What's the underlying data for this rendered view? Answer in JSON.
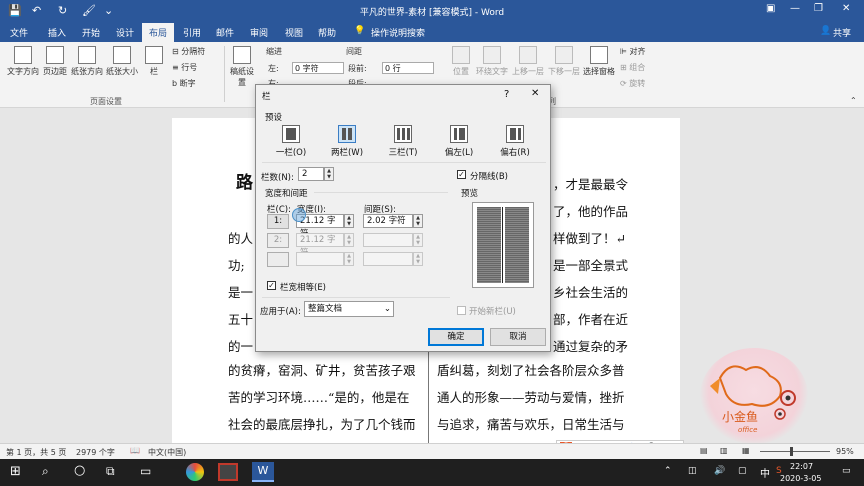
{
  "titlebar": {
    "title": "平凡的世界-素材 [兼容模式] - Word",
    "controls": {
      "min": "—",
      "restore": "❐",
      "close": "✕"
    }
  },
  "menubar": {
    "tabs": [
      "文件",
      "插入",
      "开始",
      "设计",
      "布局",
      "引用",
      "邮件",
      "审阅",
      "视图",
      "帮助"
    ],
    "search": "操作说明搜索",
    "share": "共享"
  },
  "ribbon": {
    "buttons": [
      "文字方向",
      "页边距",
      "纸张方向",
      "纸张大小",
      "栏",
      "稿纸设置"
    ],
    "breaks": "分隔符",
    "line_numbers": "行号",
    "hyphenation": "断字",
    "group_page_setup": "页面设置",
    "indent_label": "缩进",
    "indent_left_label": "左:",
    "indent_left_value": "0 字符",
    "indent_right_label": "右:",
    "spacing_label": "间距",
    "spacing_before_label": "段前:",
    "spacing_before_value": "0 行",
    "spacing_after_label": "段后:",
    "arrange": [
      "位置",
      "环绕文字",
      "上移一层",
      "下移一层",
      "选择窗格"
    ],
    "align": "对齐",
    "group": "组合",
    "rotate": "旋转",
    "group_arrange_tail": "列"
  },
  "document": {
    "left_heading": "路",
    "left_lines": [
      "的人",
      "功;",
      "是一",
      "五十",
      "的一",
      "的贫瘠，窑洞、矿井，贫苦孩子艰",
      "苦的学习环境……“是的，他是在",
      "社会的最底层挣扎，为了几个钱而"
    ],
    "right_lines": [
      "，才是最最令",
      "了，他的作品",
      "样做到了！↵",
      "是一部全景式",
      "乡社会生活的",
      "部，作者在近",
      "通过复杂的矛",
      "盾纠葛，刻划了社会各阶层众多普",
      "通人的形象——劳动与爱情，挫折",
      "与追求，痛苦与欢乐，日常生活与"
    ]
  },
  "dialog": {
    "title": "栏",
    "help": "?",
    "close": "✕",
    "presets_label": "预设",
    "presets": [
      "一栏(O)",
      "两栏(W)",
      "三栏(T)",
      "偏左(L)",
      "偏右(R)"
    ],
    "columns_label": "栏数(N):",
    "columns_value": "2",
    "separator_label": "分隔线(B)",
    "width_spacing_label": "宽度和间距",
    "col_header": "栏(C):",
    "width_header": "宽度(I):",
    "spacing_header": "间距(S):",
    "rows": [
      {
        "num": "1:",
        "width": "21.12 字符",
        "spacing": "2.02 字符"
      },
      {
        "num": "2:",
        "width": "21.12 字符",
        "spacing": ""
      }
    ],
    "equal_width_label": "栏宽相等(E)",
    "preview_label": "预览",
    "apply_label": "应用于(A):",
    "apply_value": "整篇文档",
    "new_column_label": "开始新栏(U)",
    "ok": "确定",
    "cancel": "取消"
  },
  "statusbar": {
    "page": "第 1 页，共 5 页",
    "words": "2979 个字",
    "lang": "中文(中国)",
    "zoom": "95%"
  },
  "taskbar": {
    "time": "22:07",
    "date": "2020-3-05",
    "ime": "中"
  },
  "watermark": {
    "text": "小金鱼",
    "sub": "office"
  }
}
